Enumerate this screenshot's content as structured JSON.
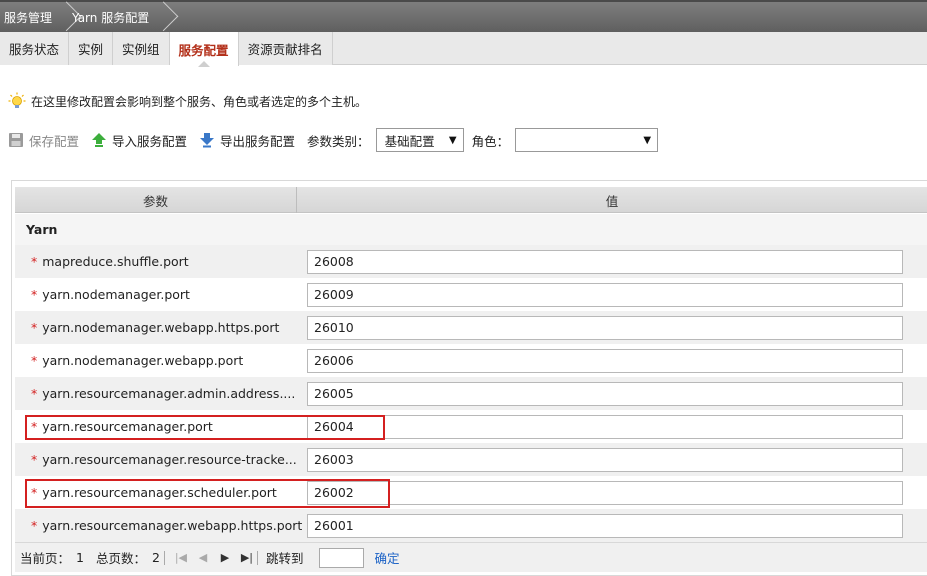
{
  "breadcrumb": [
    "服务管理",
    "Yarn 服务配置"
  ],
  "tabs": [
    {
      "label": "服务状态",
      "active": false
    },
    {
      "label": "实例",
      "active": false
    },
    {
      "label": "实例组",
      "active": false
    },
    {
      "label": "服务配置",
      "active": true
    },
    {
      "label": "资源贡献排名",
      "active": false
    }
  ],
  "hint": "在这里修改配置会影响到整个服务、角色或者选定的多个主机。",
  "toolbar": {
    "save": "保存配置",
    "import": "导入服务配置",
    "export": "导出服务配置",
    "param_type_label": "参数类别：",
    "param_type_value": "基础配置",
    "role_label": "角色：",
    "role_value": ""
  },
  "table": {
    "headers": [
      "参数",
      "值"
    ],
    "group": "Yarn",
    "rows": [
      {
        "name": "mapreduce.shuffle.port",
        "value": "26008"
      },
      {
        "name": "yarn.nodemanager.port",
        "value": "26009"
      },
      {
        "name": "yarn.nodemanager.webapp.https.port",
        "value": "26010"
      },
      {
        "name": "yarn.nodemanager.webapp.port",
        "value": "26006"
      },
      {
        "name": "yarn.resourcemanager.admin.address....",
        "value": "26005"
      },
      {
        "name": "yarn.resourcemanager.port",
        "value": "26004"
      },
      {
        "name": "yarn.resourcemanager.resource-tracke...",
        "value": "26003"
      },
      {
        "name": "yarn.resourcemanager.scheduler.port",
        "value": "26002"
      },
      {
        "name": "yarn.resourcemanager.webapp.https.port",
        "value": "26001"
      }
    ],
    "required_mark": "*"
  },
  "pager": {
    "current_label": "当前页：",
    "current": "1",
    "total_label": "总页数：",
    "total": "2",
    "jump_label": "跳转到",
    "confirm": "确定"
  },
  "icons": {
    "hint": "lightbulb-icon",
    "save": "floppy-disk-icon",
    "import": "green-up-arrow-icon",
    "export": "blue-down-arrow-icon"
  },
  "colors": {
    "active_tab": "#b3301a",
    "highlight": "#d42020",
    "link": "#1d63c6"
  }
}
